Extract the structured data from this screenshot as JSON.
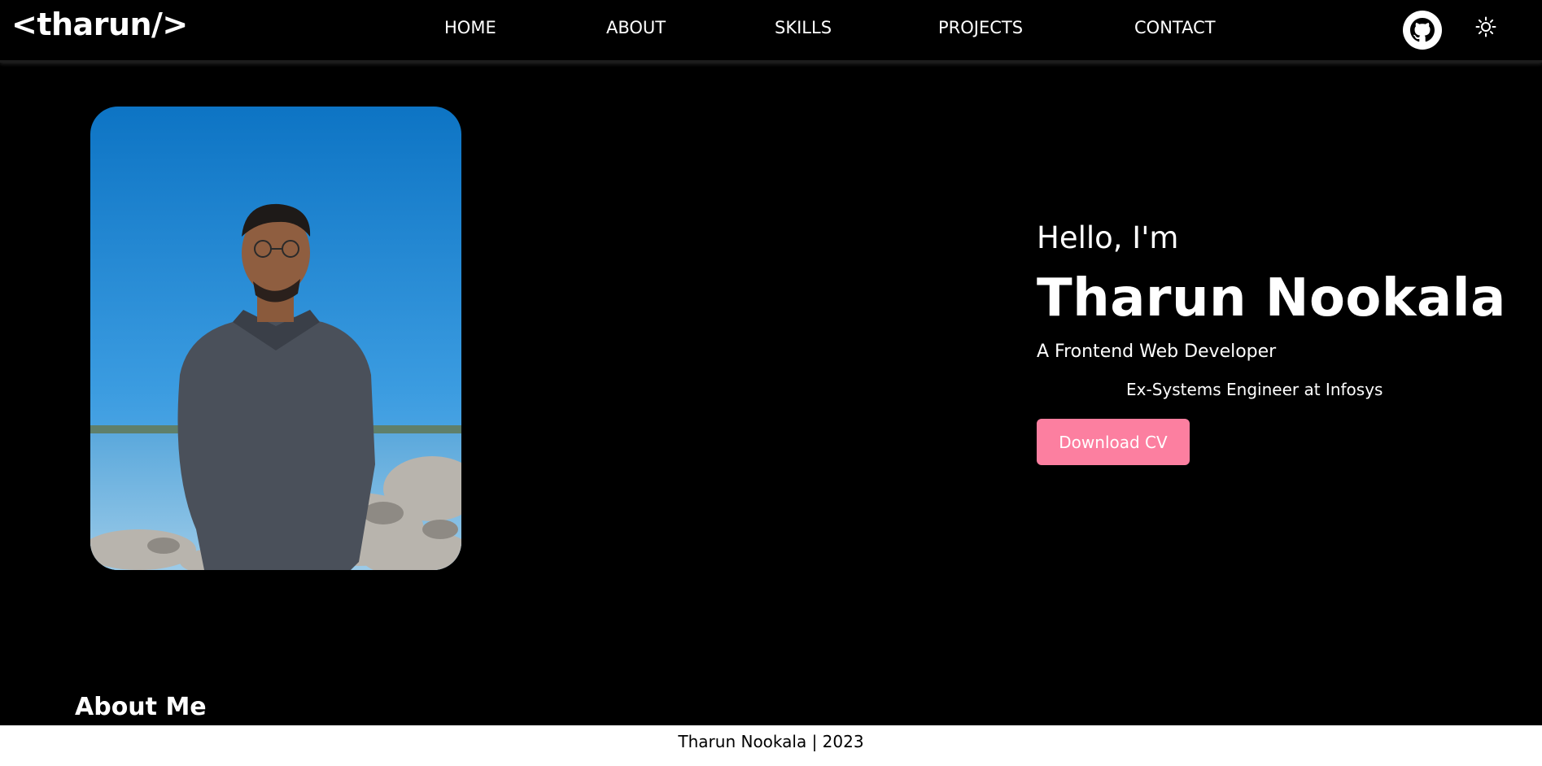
{
  "header": {
    "logo": "<tharun/>",
    "nav": [
      {
        "label": "HOME"
      },
      {
        "label": "ABOUT"
      },
      {
        "label": "SKILLS"
      },
      {
        "label": "PROJECTS"
      },
      {
        "label": "CONTACT"
      }
    ],
    "icons": {
      "github": "github-icon",
      "theme": "sun-icon"
    }
  },
  "hero": {
    "greeting": "Hello, I'm",
    "name": "Tharun Nookala",
    "role": "A Frontend Web Developer",
    "experience": "Ex-Systems Engineer at Infosys",
    "cta_label": "Download CV"
  },
  "about": {
    "title": "About Me"
  },
  "footer": {
    "text": "Tharun Nookala | 2023"
  },
  "colors": {
    "background": "#000000",
    "accent": "#fc7fa0",
    "text": "#ffffff",
    "footer_bg": "#ffffff"
  }
}
